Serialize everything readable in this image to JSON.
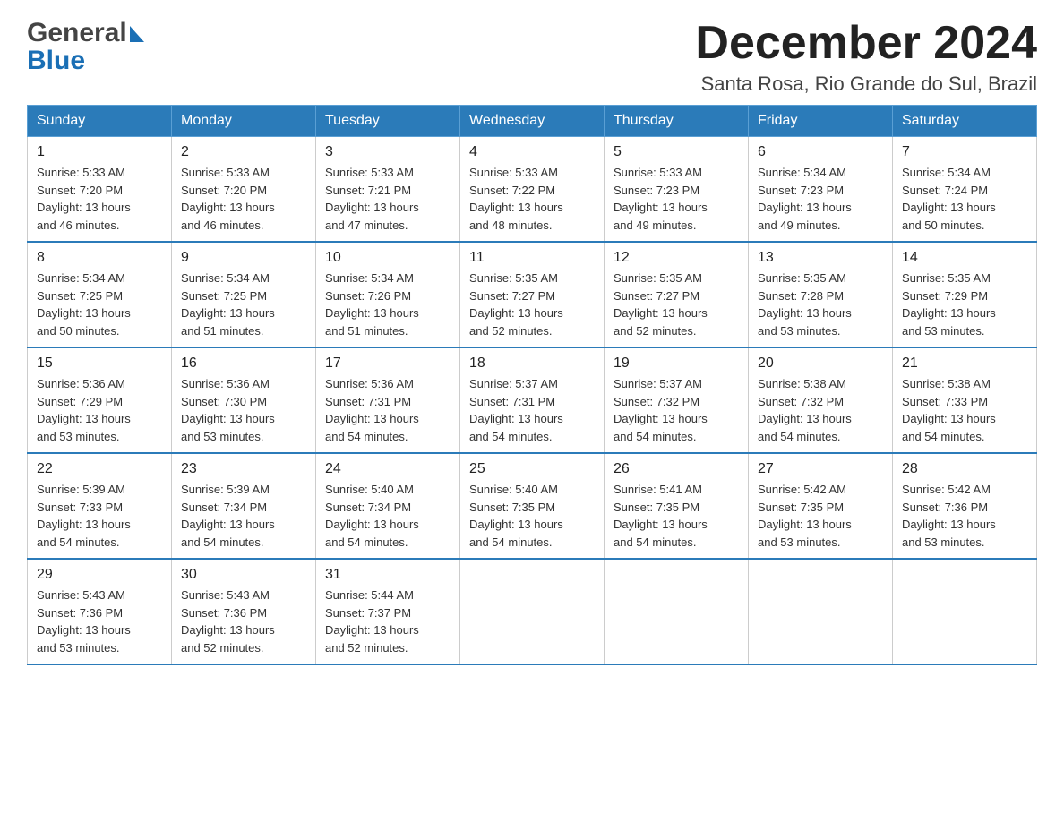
{
  "header": {
    "month_title": "December 2024",
    "location": "Santa Rosa, Rio Grande do Sul, Brazil",
    "logo_part1": "General",
    "logo_part2": "Blue"
  },
  "days_of_week": [
    "Sunday",
    "Monday",
    "Tuesday",
    "Wednesday",
    "Thursday",
    "Friday",
    "Saturday"
  ],
  "weeks": [
    [
      {
        "day": "1",
        "sunrise": "5:33 AM",
        "sunset": "7:20 PM",
        "daylight": "13 hours and 46 minutes."
      },
      {
        "day": "2",
        "sunrise": "5:33 AM",
        "sunset": "7:20 PM",
        "daylight": "13 hours and 46 minutes."
      },
      {
        "day": "3",
        "sunrise": "5:33 AM",
        "sunset": "7:21 PM",
        "daylight": "13 hours and 47 minutes."
      },
      {
        "day": "4",
        "sunrise": "5:33 AM",
        "sunset": "7:22 PM",
        "daylight": "13 hours and 48 minutes."
      },
      {
        "day": "5",
        "sunrise": "5:33 AM",
        "sunset": "7:23 PM",
        "daylight": "13 hours and 49 minutes."
      },
      {
        "day": "6",
        "sunrise": "5:34 AM",
        "sunset": "7:23 PM",
        "daylight": "13 hours and 49 minutes."
      },
      {
        "day": "7",
        "sunrise": "5:34 AM",
        "sunset": "7:24 PM",
        "daylight": "13 hours and 50 minutes."
      }
    ],
    [
      {
        "day": "8",
        "sunrise": "5:34 AM",
        "sunset": "7:25 PM",
        "daylight": "13 hours and 50 minutes."
      },
      {
        "day": "9",
        "sunrise": "5:34 AM",
        "sunset": "7:25 PM",
        "daylight": "13 hours and 51 minutes."
      },
      {
        "day": "10",
        "sunrise": "5:34 AM",
        "sunset": "7:26 PM",
        "daylight": "13 hours and 51 minutes."
      },
      {
        "day": "11",
        "sunrise": "5:35 AM",
        "sunset": "7:27 PM",
        "daylight": "13 hours and 52 minutes."
      },
      {
        "day": "12",
        "sunrise": "5:35 AM",
        "sunset": "7:27 PM",
        "daylight": "13 hours and 52 minutes."
      },
      {
        "day": "13",
        "sunrise": "5:35 AM",
        "sunset": "7:28 PM",
        "daylight": "13 hours and 53 minutes."
      },
      {
        "day": "14",
        "sunrise": "5:35 AM",
        "sunset": "7:29 PM",
        "daylight": "13 hours and 53 minutes."
      }
    ],
    [
      {
        "day": "15",
        "sunrise": "5:36 AM",
        "sunset": "7:29 PM",
        "daylight": "13 hours and 53 minutes."
      },
      {
        "day": "16",
        "sunrise": "5:36 AM",
        "sunset": "7:30 PM",
        "daylight": "13 hours and 53 minutes."
      },
      {
        "day": "17",
        "sunrise": "5:36 AM",
        "sunset": "7:31 PM",
        "daylight": "13 hours and 54 minutes."
      },
      {
        "day": "18",
        "sunrise": "5:37 AM",
        "sunset": "7:31 PM",
        "daylight": "13 hours and 54 minutes."
      },
      {
        "day": "19",
        "sunrise": "5:37 AM",
        "sunset": "7:32 PM",
        "daylight": "13 hours and 54 minutes."
      },
      {
        "day": "20",
        "sunrise": "5:38 AM",
        "sunset": "7:32 PM",
        "daylight": "13 hours and 54 minutes."
      },
      {
        "day": "21",
        "sunrise": "5:38 AM",
        "sunset": "7:33 PM",
        "daylight": "13 hours and 54 minutes."
      }
    ],
    [
      {
        "day": "22",
        "sunrise": "5:39 AM",
        "sunset": "7:33 PM",
        "daylight": "13 hours and 54 minutes."
      },
      {
        "day": "23",
        "sunrise": "5:39 AM",
        "sunset": "7:34 PM",
        "daylight": "13 hours and 54 minutes."
      },
      {
        "day": "24",
        "sunrise": "5:40 AM",
        "sunset": "7:34 PM",
        "daylight": "13 hours and 54 minutes."
      },
      {
        "day": "25",
        "sunrise": "5:40 AM",
        "sunset": "7:35 PM",
        "daylight": "13 hours and 54 minutes."
      },
      {
        "day": "26",
        "sunrise": "5:41 AM",
        "sunset": "7:35 PM",
        "daylight": "13 hours and 54 minutes."
      },
      {
        "day": "27",
        "sunrise": "5:42 AM",
        "sunset": "7:35 PM",
        "daylight": "13 hours and 53 minutes."
      },
      {
        "day": "28",
        "sunrise": "5:42 AM",
        "sunset": "7:36 PM",
        "daylight": "13 hours and 53 minutes."
      }
    ],
    [
      {
        "day": "29",
        "sunrise": "5:43 AM",
        "sunset": "7:36 PM",
        "daylight": "13 hours and 53 minutes."
      },
      {
        "day": "30",
        "sunrise": "5:43 AM",
        "sunset": "7:36 PM",
        "daylight": "13 hours and 52 minutes."
      },
      {
        "day": "31",
        "sunrise": "5:44 AM",
        "sunset": "7:37 PM",
        "daylight": "13 hours and 52 minutes."
      },
      null,
      null,
      null,
      null
    ]
  ],
  "labels": {
    "sunrise": "Sunrise:",
    "sunset": "Sunset:",
    "daylight": "Daylight:"
  }
}
